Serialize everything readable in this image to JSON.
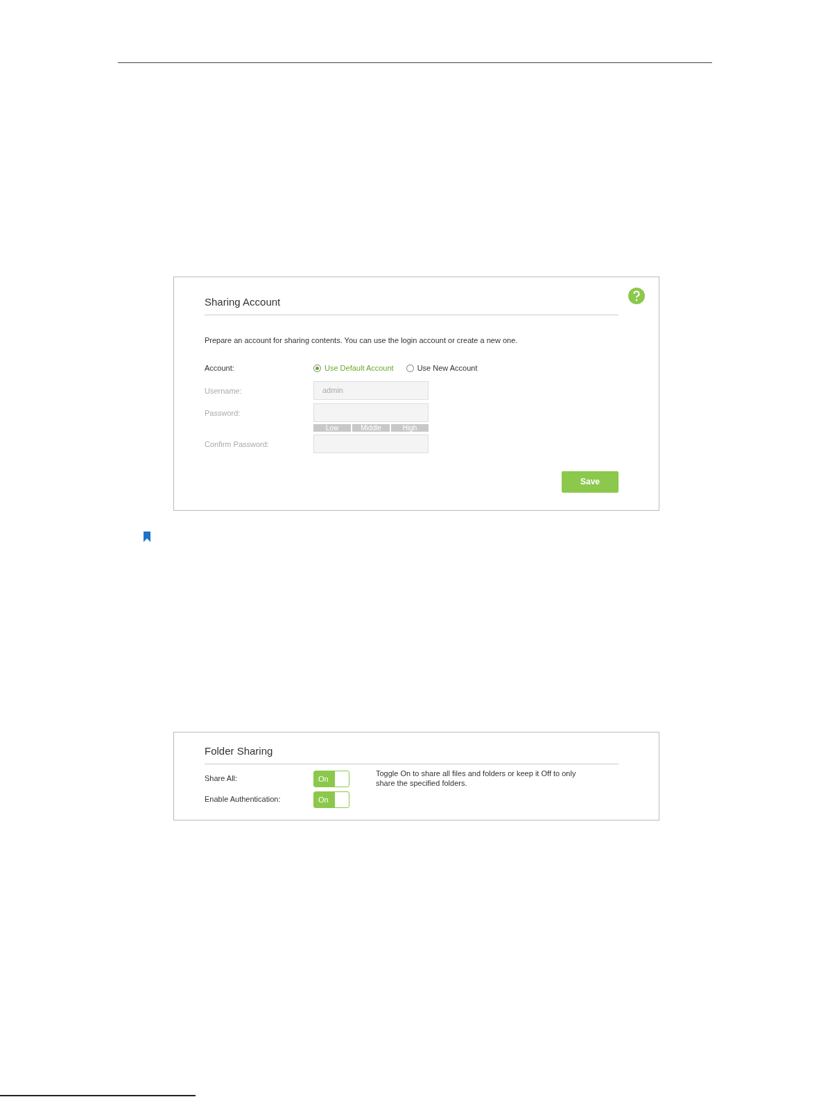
{
  "sharing_account": {
    "title": "Sharing Account",
    "description": "Prepare an account for sharing contents. You can use the login account or create a new one.",
    "account": {
      "label": "Account:",
      "options": [
        {
          "label": "Use Default Account",
          "selected": true
        },
        {
          "label": "Use New Account",
          "selected": false
        }
      ]
    },
    "fields": [
      {
        "label": "Username:",
        "value": "admin",
        "disabled": true
      },
      {
        "label": "Password:",
        "disabled": true,
        "strength": [
          "Low",
          "Middle",
          "High"
        ]
      },
      {
        "label": "Confirm Password:",
        "disabled": true
      }
    ],
    "save": "Save"
  },
  "folder_sharing": {
    "title": "Folder Sharing",
    "rows": [
      {
        "label": "Share All:",
        "toggle": "On",
        "on": true
      },
      {
        "label": "Enable Authentication:",
        "toggle": "On",
        "on": true
      }
    ],
    "hint": "Toggle On to share all files and folders or keep it Off to only share the specified folders."
  }
}
